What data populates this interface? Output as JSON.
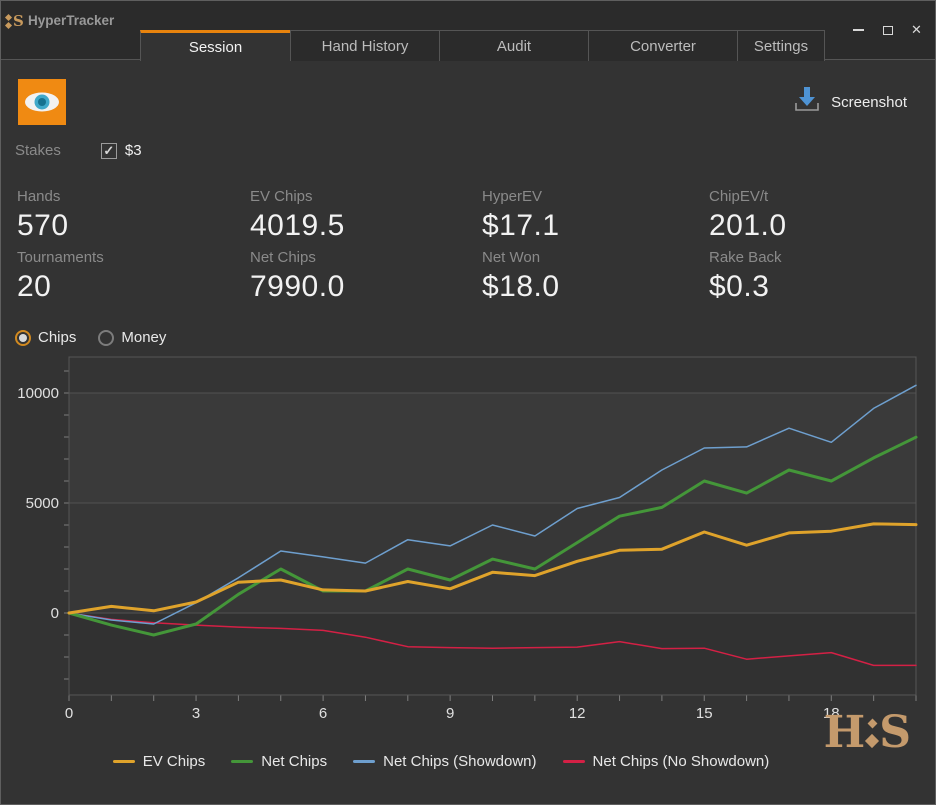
{
  "window": {
    "title": "HyperTracker",
    "controls": {
      "minimize": "minimize",
      "maximize": "maximize",
      "close": "✕"
    }
  },
  "tabs": [
    {
      "label": "Session",
      "active": true
    },
    {
      "label": "Hand History",
      "active": false
    },
    {
      "label": "Audit",
      "active": false
    },
    {
      "label": "Converter",
      "active": false
    },
    {
      "label": "Settings",
      "active": false
    }
  ],
  "toolbar": {
    "screenshot_label": "Screenshot"
  },
  "filters": {
    "stakes_label": "Stakes",
    "stakes_checked": true,
    "stakes_value": "$3",
    "check_glyph": "✓"
  },
  "stats": [
    {
      "label": "Hands",
      "value": "570"
    },
    {
      "label": "EV Chips",
      "value": "4019.5"
    },
    {
      "label": "HyperEV",
      "value": "$17.1"
    },
    {
      "label": "ChipEV/t",
      "value": "201.0"
    },
    {
      "label": "Tournaments",
      "value": "20"
    },
    {
      "label": "Net Chips",
      "value": "7990.0"
    },
    {
      "label": "Net Won",
      "value": "$18.0"
    },
    {
      "label": "Rake Back",
      "value": "$0.3"
    }
  ],
  "view_toggle": {
    "options": [
      {
        "label": "Chips",
        "selected": true
      },
      {
        "label": "Money",
        "selected": false
      }
    ]
  },
  "colors": {
    "accent_orange": "#e8830d",
    "eye_bg": "#f08a12",
    "screenshot_arrow": "#4e93d4",
    "logo_gold": "#c49a6c",
    "ev_chips": "#dfa32b",
    "net_chips": "#449639",
    "net_chips_showdown": "#6e9fce",
    "net_chips_no_showdown": "#d42045"
  },
  "chart_data": {
    "type": "line",
    "x": [
      0,
      1,
      2,
      3,
      4,
      5,
      6,
      7,
      8,
      9,
      10,
      11,
      12,
      13,
      14,
      15,
      16,
      17,
      18,
      19,
      20
    ],
    "xticks": [
      0,
      3,
      6,
      9,
      12,
      15,
      18
    ],
    "yticks": [
      0,
      5000,
      10000
    ],
    "ylim": [
      -3727,
      11636
    ],
    "xlim": [
      0,
      20
    ],
    "xlabel": "",
    "ylabel": "",
    "grid": true,
    "legend_position": "bottom",
    "series": [
      {
        "name": "EV Chips",
        "color": "#dfa32b",
        "width": 3,
        "values": [
          0,
          300,
          100,
          500,
          1400,
          1500,
          1050,
          1000,
          1430,
          1100,
          1850,
          1700,
          2350,
          2850,
          2900,
          3680,
          3080,
          3640,
          3720,
          4050,
          4019.5
        ]
      },
      {
        "name": "Net Chips",
        "color": "#449639",
        "width": 3,
        "values": [
          0,
          -550,
          -1000,
          -500,
          850,
          2000,
          1000,
          1000,
          2000,
          1500,
          2450,
          2000,
          3200,
          4400,
          4800,
          6000,
          5450,
          6500,
          6000,
          7050,
          7990
        ]
      },
      {
        "name": "Net Chips (Showdown)",
        "color": "#6e9fce",
        "width": 1.5,
        "values": [
          0,
          -320,
          -500,
          470,
          1600,
          2820,
          2550,
          2270,
          3330,
          3050,
          4000,
          3500,
          4750,
          5250,
          6500,
          7500,
          7550,
          8400,
          7760,
          9300,
          10350
        ]
      },
      {
        "name": "Net Chips (No Showdown)",
        "color": "#d42045",
        "width": 1.5,
        "values": [
          0,
          -290,
          -440,
          -550,
          -640,
          -700,
          -790,
          -1100,
          -1530,
          -1575,
          -1600,
          -1575,
          -1550,
          -1300,
          -1620,
          -1600,
          -2100,
          -1950,
          -1800,
          -2380,
          -2380
        ]
      }
    ]
  }
}
